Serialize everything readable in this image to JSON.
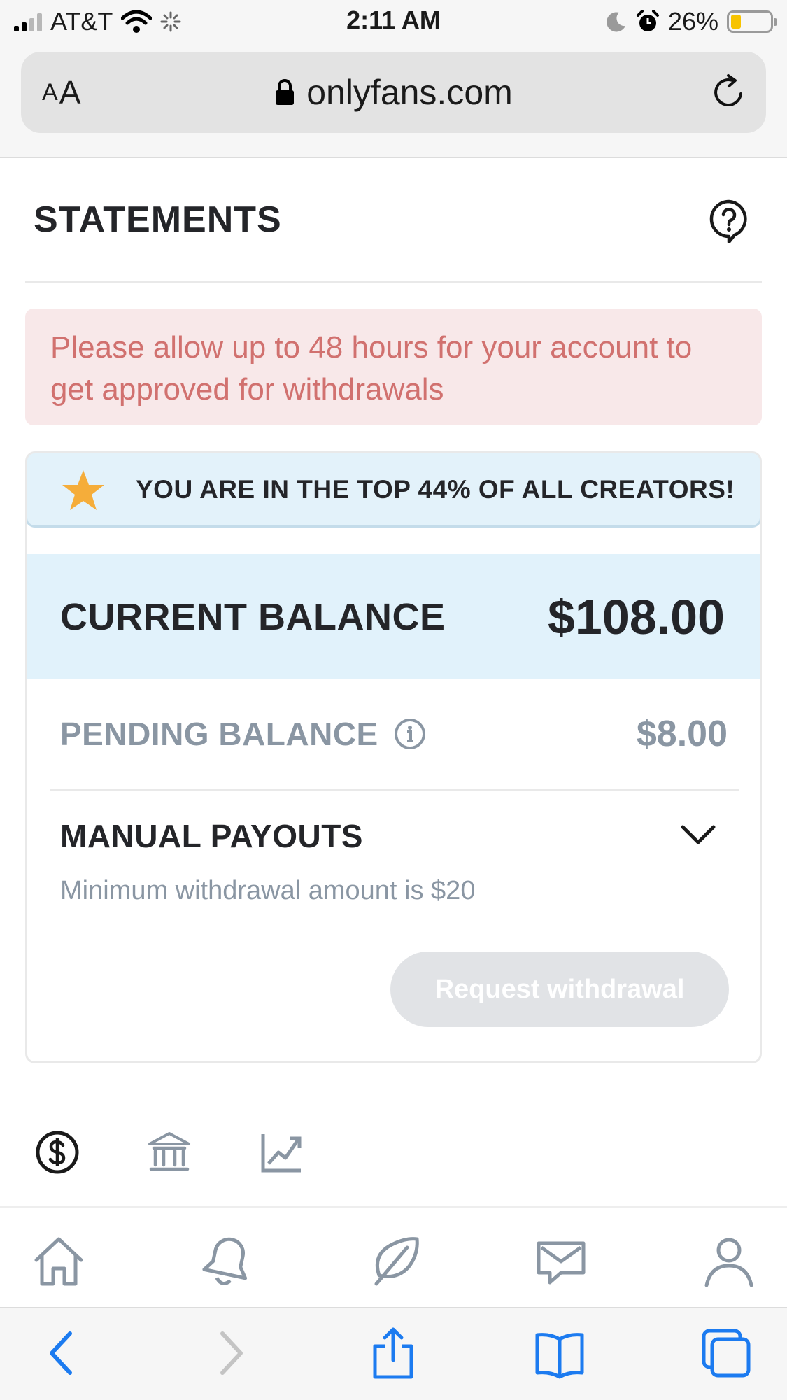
{
  "status_bar": {
    "carrier": "AT&T",
    "time": "2:11 AM",
    "battery": "26%",
    "battery_level": 0.26,
    "icons": [
      "signal-icon",
      "wifi-icon",
      "activity-spinner-icon",
      "moon-icon",
      "alarm-icon",
      "battery-icon"
    ]
  },
  "address_bar": {
    "text_size_label_small": "A",
    "text_size_label_large": "A",
    "url": "onlyfans.com",
    "icons": [
      "lock-icon",
      "reload-icon"
    ]
  },
  "page": {
    "title": "STATEMENTS",
    "help_icon": "question-bubble-icon"
  },
  "alert": {
    "message": "Please allow up to 48 hours for your account to get approved for withdrawals"
  },
  "balance_card": {
    "top_creators_text": "YOU ARE IN THE TOP 44% OF ALL CREATORS!",
    "current_balance_label": "CURRENT BALANCE",
    "current_balance_value": "$108.00",
    "pending_balance_label": "PENDING BALANCE",
    "pending_balance_value": "$8.00",
    "manual_payouts_label": "MANUAL PAYOUTS",
    "minimum_text": "Minimum withdrawal amount is $20",
    "request_button": "Request withdrawal"
  },
  "statement_tabs": [
    "dollar-circle-icon",
    "bank-icon",
    "chart-trend-icon"
  ],
  "app_nav": [
    "home-icon",
    "bell-icon",
    "feather-icon",
    "message-icon",
    "profile-icon"
  ],
  "safari_toolbar": [
    "back-icon",
    "forward-icon",
    "share-icon",
    "bookmarks-icon",
    "tabs-icon"
  ],
  "colors": {
    "alert_bg": "#f8e8e9",
    "alert_text": "#d1716f",
    "banner_bg": "#e3f2fa",
    "star": "#f5ad3a",
    "muted_text": "#8a96a3",
    "disabled_button": "#e1e3e6",
    "safari_blue": "#1c7bf0"
  }
}
